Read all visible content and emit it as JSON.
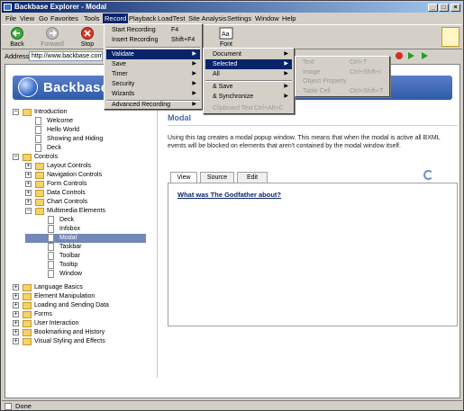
{
  "window": {
    "title": "Backbase Explorer - Modal"
  },
  "menubar": {
    "items": [
      "File",
      "View",
      "Go",
      "Favorites",
      "Tools",
      "Record",
      "Playback",
      "LoadTest",
      "Site Analysis",
      "Settings",
      "Window",
      "Help"
    ]
  },
  "toolbar": {
    "back": "Back",
    "forward": "Forward",
    "stop": "Stop",
    "font": "Font"
  },
  "address": {
    "label": "Address",
    "value": "http://www.backbase.com/"
  },
  "banner": {
    "title": "Backbase"
  },
  "record_menu": {
    "start": "Start Recording",
    "start_key": "F4",
    "insert": "Insert Recording",
    "insert_key": "Shift+F4",
    "items": [
      "Validate",
      "Save",
      "Timer",
      "Security",
      "Wizards"
    ],
    "advanced": "Advanced Recording"
  },
  "validate_menu": {
    "items": [
      "Document",
      "Selected",
      "All"
    ],
    "save": "& Save",
    "synchronize": "& Synchronize",
    "clipboard": "Clipboard Text",
    "clipboard_key": "Ctrl+Alt+C"
  },
  "selected_menu": {
    "items": [
      {
        "label": "Text",
        "key": "Ctrl+T"
      },
      {
        "label": "Image",
        "key": "Ctrl+Shift+I"
      },
      {
        "label": "Object Property",
        "key": ""
      },
      {
        "label": "Table Cell",
        "key": "Ctrl+Shift+T"
      }
    ]
  },
  "tree": {
    "items": [
      "Introduction",
      "Welcome",
      "Hello World",
      "Showing and Hiding",
      "Deck",
      "Controls",
      "Layout Controls",
      "Navigation Controls",
      "Form Controls",
      "Data Controls",
      "Chart Controls",
      "Multimedia Elements",
      "Deck",
      "Infobox",
      "Modal",
      "Taskbar",
      "Toolbar",
      "Tooltip",
      "Window",
      "Language Basics",
      "Element Manipulation",
      "Loading and Sending Data",
      "Forms",
      "User Interaction",
      "Bookmarking and History",
      "Visual Styling and Effects"
    ]
  },
  "detail": {
    "title": "Modal",
    "description": "Using this tag creates a modal popup window. This means that when the modal is active all BXML events will be blocked on elements that aren't contained by the modal window itself.",
    "tabs": [
      "View",
      "Source",
      "Edit"
    ],
    "question": "What was The Godfather about?"
  },
  "status": {
    "text": "Done"
  }
}
